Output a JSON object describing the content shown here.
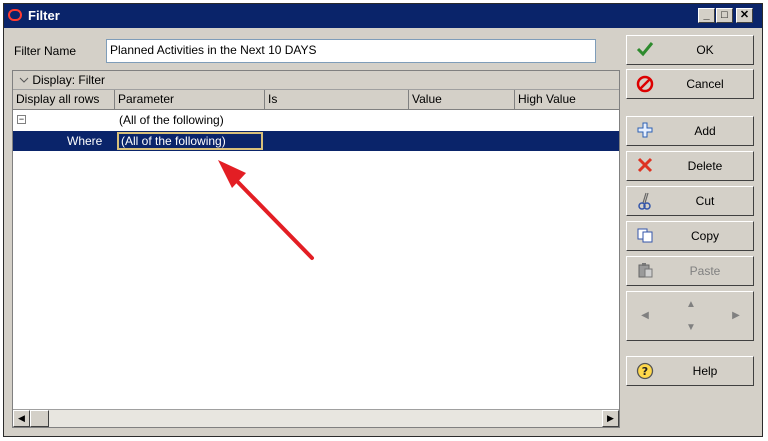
{
  "window": {
    "title": "Filter",
    "minimize": "_",
    "maximize": "□",
    "close": "✕"
  },
  "filter_name": {
    "label": "Filter Name",
    "value": "Planned Activities in the Next 10 DAYS"
  },
  "display_bar": {
    "label": "Display: Filter"
  },
  "columns": [
    "Display all rows",
    "Parameter",
    "Is",
    "Value",
    "High Value"
  ],
  "rows": [
    {
      "expander": "−",
      "where": "",
      "parameter": "(All of the following)"
    },
    {
      "where": "Where",
      "parameter": "(All of the following)"
    }
  ],
  "buttons": {
    "ok": "OK",
    "cancel": "Cancel",
    "add": "Add",
    "delete": "Delete",
    "cut": "Cut",
    "copy": "Copy",
    "paste": "Paste",
    "help": "Help"
  },
  "colors": {
    "accent": "#0a246a",
    "selection": "#0a246a",
    "annotation_arrow": "#e31e24"
  }
}
